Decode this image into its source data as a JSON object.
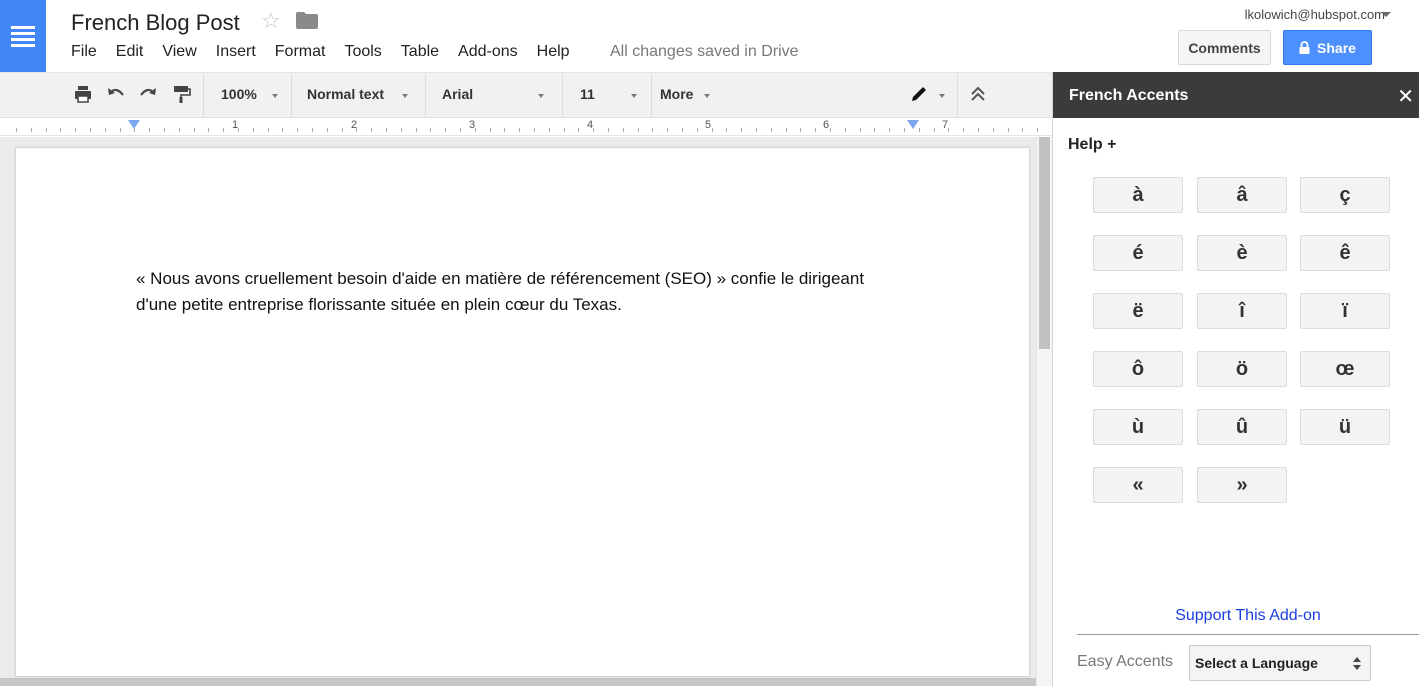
{
  "app": {
    "accent_color": "#4285f4"
  },
  "header": {
    "doc_title": "French Blog Post",
    "menu": [
      "File",
      "Edit",
      "View",
      "Insert",
      "Format",
      "Tools",
      "Table",
      "Add-ons",
      "Help"
    ],
    "save_status": "All changes saved in Drive",
    "account": "lkolowich@hubspot.com",
    "comments_label": "Comments",
    "share_label": "Share"
  },
  "toolbar": {
    "zoom": "100%",
    "style": "Normal text",
    "font": "Arial",
    "font_size": "11",
    "more": "More"
  },
  "ruler": {
    "numbers": [
      "1",
      "2",
      "3",
      "4",
      "5",
      "6",
      "7"
    ]
  },
  "document": {
    "paragraph": "« Nous avons cruellement besoin d'aide en matière de référencement (SEO) » confie le dirigeant d'une petite entreprise florissante située en plein cœur du Texas."
  },
  "panel": {
    "title": "French Accents",
    "close_icon": "close-icon",
    "help_label": "Help +",
    "accents": [
      "à",
      "â",
      "ç",
      "é",
      "è",
      "ê",
      "ë",
      "î",
      "ï",
      "ô",
      "ö",
      "œ",
      "ù",
      "û",
      "ü",
      "«",
      "»"
    ],
    "support_link": "Support This Add-on",
    "easy_accents_label": "Easy Accents",
    "language_select": "Select a Language"
  }
}
